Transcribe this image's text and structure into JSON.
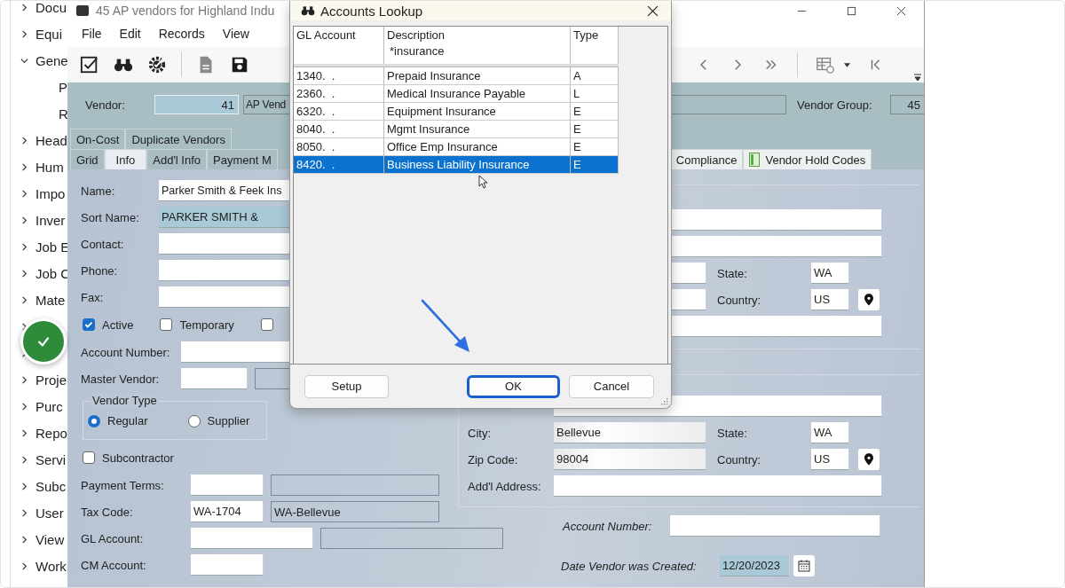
{
  "sidebar": {
    "items": [
      {
        "label": "Docu",
        "expanded": false
      },
      {
        "label": "Equi",
        "expanded": false
      },
      {
        "label": "Gene",
        "expanded": true,
        "children": [
          {
            "label": "P"
          },
          {
            "label": "R"
          }
        ]
      },
      {
        "label": "Head",
        "expanded": false
      },
      {
        "label": "Hum",
        "expanded": false
      },
      {
        "label": "Impo",
        "expanded": false
      },
      {
        "label": "Inver",
        "expanded": false
      },
      {
        "label": "Job E",
        "expanded": false
      },
      {
        "label": "Job C",
        "expanded": false
      },
      {
        "label": "Mate",
        "expanded": false
      },
      {
        "expanded": false
      },
      {
        "expanded": false
      },
      {
        "label": "Proje",
        "expanded": false
      },
      {
        "label": "Purc",
        "expanded": false
      },
      {
        "label": "Repo",
        "expanded": false
      },
      {
        "label": "Servi",
        "expanded": false
      },
      {
        "label": "Subc",
        "expanded": false
      },
      {
        "label": "User",
        "expanded": false
      },
      {
        "label": "View",
        "expanded": false
      },
      {
        "label": "Work",
        "expanded": false
      }
    ]
  },
  "window": {
    "title": "45 AP vendors for Highland Indu"
  },
  "menu": [
    "File",
    "Edit",
    "Records",
    "View"
  ],
  "header": {
    "vendor_label": "Vendor:",
    "vendor_number": "41",
    "vendor_name": "AP Vend",
    "group_label": "Vendor Group:",
    "group_value": "45"
  },
  "tabs_row_1": [
    {
      "label": "On-Cost",
      "selected": false
    },
    {
      "label": "Duplicate Vendors",
      "selected": false
    }
  ],
  "tabs_row_2": {
    "left": [
      {
        "label": "Grid",
        "selected": false
      },
      {
        "label": "Info",
        "selected": true
      },
      {
        "label": "Add'l Info",
        "selected": false
      },
      {
        "label": "Payment M",
        "selected": false
      }
    ],
    "right": [
      {
        "label": "Compliance",
        "selected": false,
        "icon": false
      },
      {
        "label": "Vendor Hold Codes",
        "selected": false,
        "icon": true
      }
    ]
  },
  "info": {
    "name": {
      "label": "Name:",
      "value": "Parker Smith & Feek Ins"
    },
    "sort_name": {
      "label": "Sort Name:",
      "value": "PARKER SMITH &"
    },
    "contact": {
      "label": "Contact:"
    },
    "phone": {
      "label": "Phone:"
    },
    "fax": {
      "label": "Fax:"
    },
    "flags": [
      {
        "label": "Active",
        "checked": true
      },
      {
        "label": "Temporary",
        "checked": false
      },
      {
        "checked": false
      }
    ],
    "account_number": {
      "label": "Account Number:"
    },
    "master_vendor": {
      "label": "Master Vendor:"
    },
    "vendor_type": {
      "title": "Vendor Type",
      "options": [
        {
          "label": "Regular",
          "selected": true
        },
        {
          "label": "Supplier",
          "selected": false
        }
      ]
    },
    "subcontractor": {
      "label": "Subcontractor",
      "checked": false
    },
    "payment_terms": {
      "label": "Payment Terms:"
    },
    "tax_code": {
      "label": "Tax Code:",
      "value": "WA-1704",
      "description": "WA-Bellevue"
    },
    "gl_account": {
      "label": "GL Account:"
    },
    "cm_account": {
      "label": "CM Account:"
    }
  },
  "address_upper": {
    "state": {
      "label": "State:",
      "value": "WA"
    },
    "country": {
      "label": "Country:",
      "value": "US"
    }
  },
  "address_lower": {
    "city": {
      "label": "City:",
      "value": "Bellevue"
    },
    "state": {
      "label": "State:",
      "value": "WA"
    },
    "zip": {
      "label": "Zip Code:",
      "value": "98004"
    },
    "country": {
      "label": "Country:",
      "value": "US"
    },
    "additional": {
      "label": "Add'l Address:"
    }
  },
  "account_number_extra": {
    "label": "Account Number:"
  },
  "date_created": {
    "label": "Date Vendor was Created:",
    "value": "12/20/2023"
  },
  "dialog": {
    "title": "Accounts Lookup",
    "columns": [
      {
        "label": "GL Account"
      },
      {
        "label": "Description",
        "filter": "*insurance"
      },
      {
        "label": "Type"
      }
    ],
    "rows": [
      {
        "cells": [
          "1340.  .",
          "Prepaid Insurance",
          "A"
        ],
        "selected": false
      },
      {
        "cells": [
          "2360.  .",
          "Medical Insurance Payable",
          "L"
        ],
        "selected": false
      },
      {
        "cells": [
          "6320.  .",
          "Equipment Insurance",
          "E"
        ],
        "selected": false
      },
      {
        "cells": [
          "8040.  .",
          "Mgmt Insurance",
          "E"
        ],
        "selected": false
      },
      {
        "cells": [
          "8050.  .",
          "Office Emp Insurance",
          "E"
        ],
        "selected": false
      },
      {
        "cells": [
          "8420.  .",
          "Business Liability Insurance",
          "E"
        ],
        "selected": true
      }
    ],
    "buttons": [
      {
        "label": "Setup",
        "focused": false
      },
      {
        "label": "OK",
        "focused": true
      },
      {
        "label": "Cancel",
        "focused": false
      }
    ]
  }
}
